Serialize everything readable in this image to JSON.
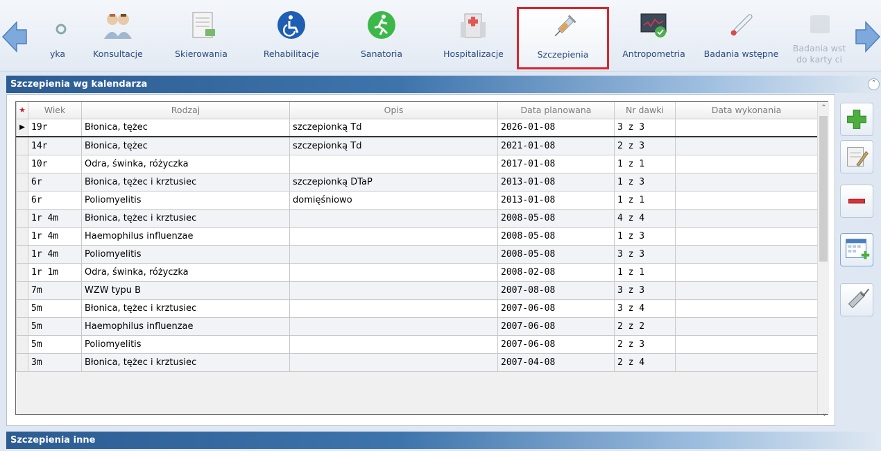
{
  "toolbar": {
    "items": [
      {
        "label": "yka",
        "icon": "stethoscope-icon"
      },
      {
        "label": "Konsultacje",
        "icon": "doctors-icon"
      },
      {
        "label": "Skierowania",
        "icon": "document-icon"
      },
      {
        "label": "Rehabilitacje",
        "icon": "wheelchair-icon"
      },
      {
        "label": "Sanatoria",
        "icon": "runner-icon"
      },
      {
        "label": "Hospitalizacje",
        "icon": "hospital-icon"
      },
      {
        "label": "Szczepienia",
        "icon": "syringe-icon"
      },
      {
        "label": "Antropometria",
        "icon": "monitor-check-icon"
      },
      {
        "label": "Badania wstępne",
        "icon": "thermometer-icon"
      },
      {
        "label": "Badania wst",
        "label2": "do karty ci",
        "icon": "card-icon"
      }
    ]
  },
  "section1": {
    "title": "Szczepienia wg kalendarza"
  },
  "section2": {
    "title": "Szczepienia inne"
  },
  "grid": {
    "columns": [
      "Wiek",
      "Rodzaj",
      "Opis",
      "Data planowana",
      "Nr dawki",
      "Data wykonania"
    ],
    "rows": [
      {
        "wiek": "19r",
        "rodzaj": "Błonica, tężec",
        "opis": "szczepionką Td",
        "data": "2026-01-08",
        "dawka": "3 z 3",
        "wykonania": ""
      },
      {
        "wiek": "14r",
        "rodzaj": "Błonica, tężec",
        "opis": "szczepionką Td",
        "data": "2021-01-08",
        "dawka": "2 z 3",
        "wykonania": ""
      },
      {
        "wiek": "10r",
        "rodzaj": "Odra, świnka, różyczka",
        "opis": "",
        "data": "2017-01-08",
        "dawka": "1 z 1",
        "wykonania": ""
      },
      {
        "wiek": "6r",
        "rodzaj": "Błonica, tężec i krztusiec",
        "opis": "szczepionką DTaP",
        "data": "2013-01-08",
        "dawka": "1 z 3",
        "wykonania": ""
      },
      {
        "wiek": "6r",
        "rodzaj": "Poliomyelitis",
        "opis": "domięśniowo",
        "data": "2013-01-08",
        "dawka": "1 z 1",
        "wykonania": ""
      },
      {
        "wiek": "1r 4m",
        "rodzaj": "Błonica, tężec i krztusiec",
        "opis": "",
        "data": "2008-05-08",
        "dawka": "4 z 4",
        "wykonania": ""
      },
      {
        "wiek": "1r 4m",
        "rodzaj": "Haemophilus influenzae",
        "opis": "",
        "data": "2008-05-08",
        "dawka": "1 z 3",
        "wykonania": ""
      },
      {
        "wiek": "1r 4m",
        "rodzaj": "Poliomyelitis",
        "opis": "",
        "data": "2008-05-08",
        "dawka": "3 z 3",
        "wykonania": ""
      },
      {
        "wiek": "1r 1m",
        "rodzaj": "Odra, świnka, różyczka",
        "opis": "",
        "data": "2008-02-08",
        "dawka": "1 z 1",
        "wykonania": ""
      },
      {
        "wiek": "7m",
        "rodzaj": "WZW typu B",
        "opis": "",
        "data": "2007-08-08",
        "dawka": "3 z 3",
        "wykonania": ""
      },
      {
        "wiek": "5m",
        "rodzaj": "Błonica, tężec i krztusiec",
        "opis": "",
        "data": "2007-06-08",
        "dawka": "3 z 4",
        "wykonania": ""
      },
      {
        "wiek": "5m",
        "rodzaj": "Haemophilus influenzae",
        "opis": "",
        "data": "2007-06-08",
        "dawka": "2 z 2",
        "wykonania": ""
      },
      {
        "wiek": "5m",
        "rodzaj": "Poliomyelitis",
        "opis": "",
        "data": "2007-06-08",
        "dawka": "2 z 3",
        "wykonania": ""
      },
      {
        "wiek": "3m",
        "rodzaj": "Błonica, tężec i krztusiec",
        "opis": "",
        "data": "2007-04-08",
        "dawka": "2 z 4",
        "wykonania": ""
      }
    ]
  },
  "colors": {
    "active_border": "#d9262f",
    "header_blue": "#2c5c92",
    "label_blue": "#2a4a86"
  }
}
